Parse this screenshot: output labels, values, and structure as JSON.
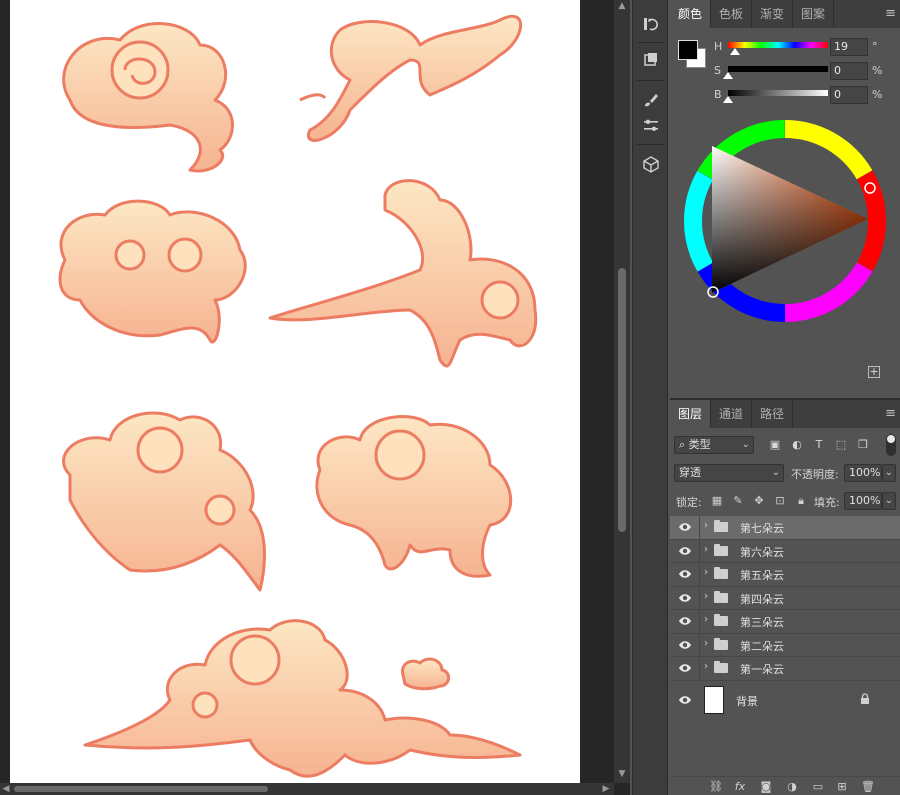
{
  "color_panel": {
    "tabs": [
      {
        "label": "颜色",
        "active": true
      },
      {
        "label": "色板",
        "active": false
      },
      {
        "label": "渐变",
        "active": false
      },
      {
        "label": "图案",
        "active": false
      }
    ],
    "foreground_color": "#000000",
    "background_color": "#ffffff",
    "sliders": [
      {
        "label": "H",
        "value": "19",
        "unit": "°"
      },
      {
        "label": "S",
        "value": "0",
        "unit": "%"
      },
      {
        "label": "B",
        "value": "0",
        "unit": "%"
      }
    ]
  },
  "layers_panel": {
    "tabs": [
      {
        "label": "图层",
        "active": true
      },
      {
        "label": "通道",
        "active": false
      },
      {
        "label": "路径",
        "active": false
      }
    ],
    "filter": {
      "kind": "类型"
    },
    "blend_mode": "穿透",
    "opacity_label": "不透明度:",
    "opacity_value": "100%",
    "lock_label": "锁定:",
    "fill_label": "填充:",
    "fill_value": "100%",
    "layers": [
      {
        "name": "第七朵云",
        "selected": true
      },
      {
        "name": "第六朵云",
        "selected": false
      },
      {
        "name": "第五朵云",
        "selected": false
      },
      {
        "name": "第四朵云",
        "selected": false
      },
      {
        "name": "第三朵云",
        "selected": false
      },
      {
        "name": "第二朵云",
        "selected": false
      },
      {
        "name": "第一朵云",
        "selected": false
      }
    ],
    "background_layer": {
      "name": "背景"
    },
    "footer_fx": "fx"
  },
  "canvas": {
    "cloud_fill": "#f9c7a3",
    "cloud_light": "#fde7c4",
    "cloud_stroke": "#ec7c62"
  }
}
